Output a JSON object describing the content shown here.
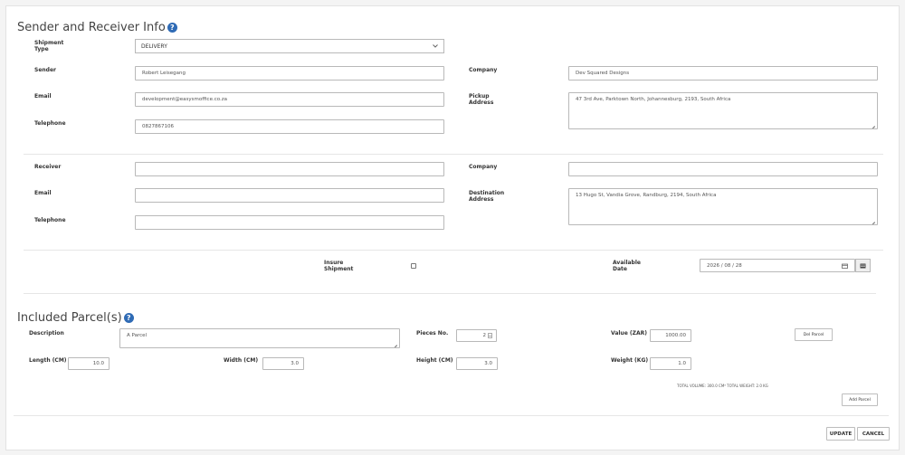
{
  "sender_section": {
    "title": "Sender and Receiver Info",
    "help_icon": "question-circle-icon",
    "shipment_type_label": "Shipment\nType",
    "shipment_type_value": "DELIVERY",
    "sender_label": "Sender",
    "sender_value": "Robert Leisegang",
    "email_label": "Email",
    "email_value": "development@easysmoffice.co.za",
    "telephone_label": "Telephone",
    "telephone_value": "0827867106",
    "company_label": "Company",
    "company_value": "Dev Squared Designs",
    "pickup_address_label": "Pickup\nAddress",
    "pickup_address_value": "47 3rd Ave, Parktown North, Johannesburg, 2193, South Africa"
  },
  "receiver_section": {
    "receiver_label": "Receiver",
    "receiver_value": "",
    "email_label": "Email",
    "email_value": "",
    "telephone_label": "Telephone",
    "telephone_value": "",
    "company_label": "Company",
    "company_value": "",
    "destination_address_label": "Destination\nAddress",
    "destination_address_value": "13 Hugo St, Vandia Grove, Randburg, 2194, South Africa"
  },
  "options": {
    "insure_label": "Insure\nShipment",
    "insure_checked": false,
    "available_date_label": "Available\nDate",
    "available_date_value": "2026 / 08 / 28",
    "calendar_icon": "calendar-icon"
  },
  "parcels": {
    "title": "Included Parcel(s)",
    "help_icon": "question-circle-icon",
    "description_label": "Description",
    "description_value": "A Parcel",
    "pieces_label": "Pieces No.",
    "pieces_value": "2",
    "value_label": "Value (ZAR)",
    "value_value": "1000.00",
    "del_parcel_label": "Del Parcel",
    "length_label": "Length (CM)",
    "length_value": "10.0",
    "width_label": "Width (CM)",
    "width_value": "3.0",
    "height_label": "Height (CM)",
    "height_value": "3.0",
    "weight_label": "Weight (KG)",
    "weight_value": "1.0",
    "totals_text": "TOTAL VOLUME: 300.0 CM³ TOTAL WEIGHT: 2.0 KG",
    "add_parcel_label": "Add Parcel"
  },
  "footer": {
    "update_label": "UPDATE",
    "cancel_label": "CANCEL"
  }
}
